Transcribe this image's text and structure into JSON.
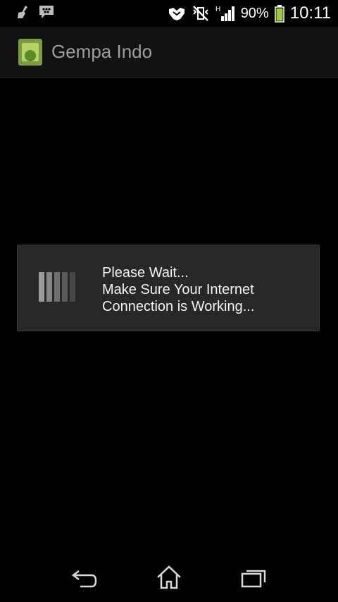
{
  "status_bar": {
    "battery_percent": "90%",
    "time": "10:11",
    "network_type": "H",
    "icons": [
      "cleaner-icon",
      "bbm-icon",
      "handshake-icon",
      "vibrate-off-icon",
      "signal-icon",
      "battery-icon"
    ]
  },
  "action_bar": {
    "title": "Gempa Indo",
    "app_icon": "android-app-icon"
  },
  "dialog": {
    "line1": "Please Wait...",
    "line2": "Make Sure Your Internet",
    "line3": "Connection is Working...",
    "spinner_colors": [
      "#9a9a9a",
      "#858585",
      "#6e6e6e",
      "#5a5a5a",
      "#474747"
    ]
  },
  "nav_bar": {
    "icons": [
      "back-icon",
      "home-icon",
      "recent-apps-icon"
    ]
  },
  "colors": {
    "background": "#000000",
    "action_bar": "#121212",
    "dialog": "#282828",
    "battery_green": "#9ccc3c"
  }
}
